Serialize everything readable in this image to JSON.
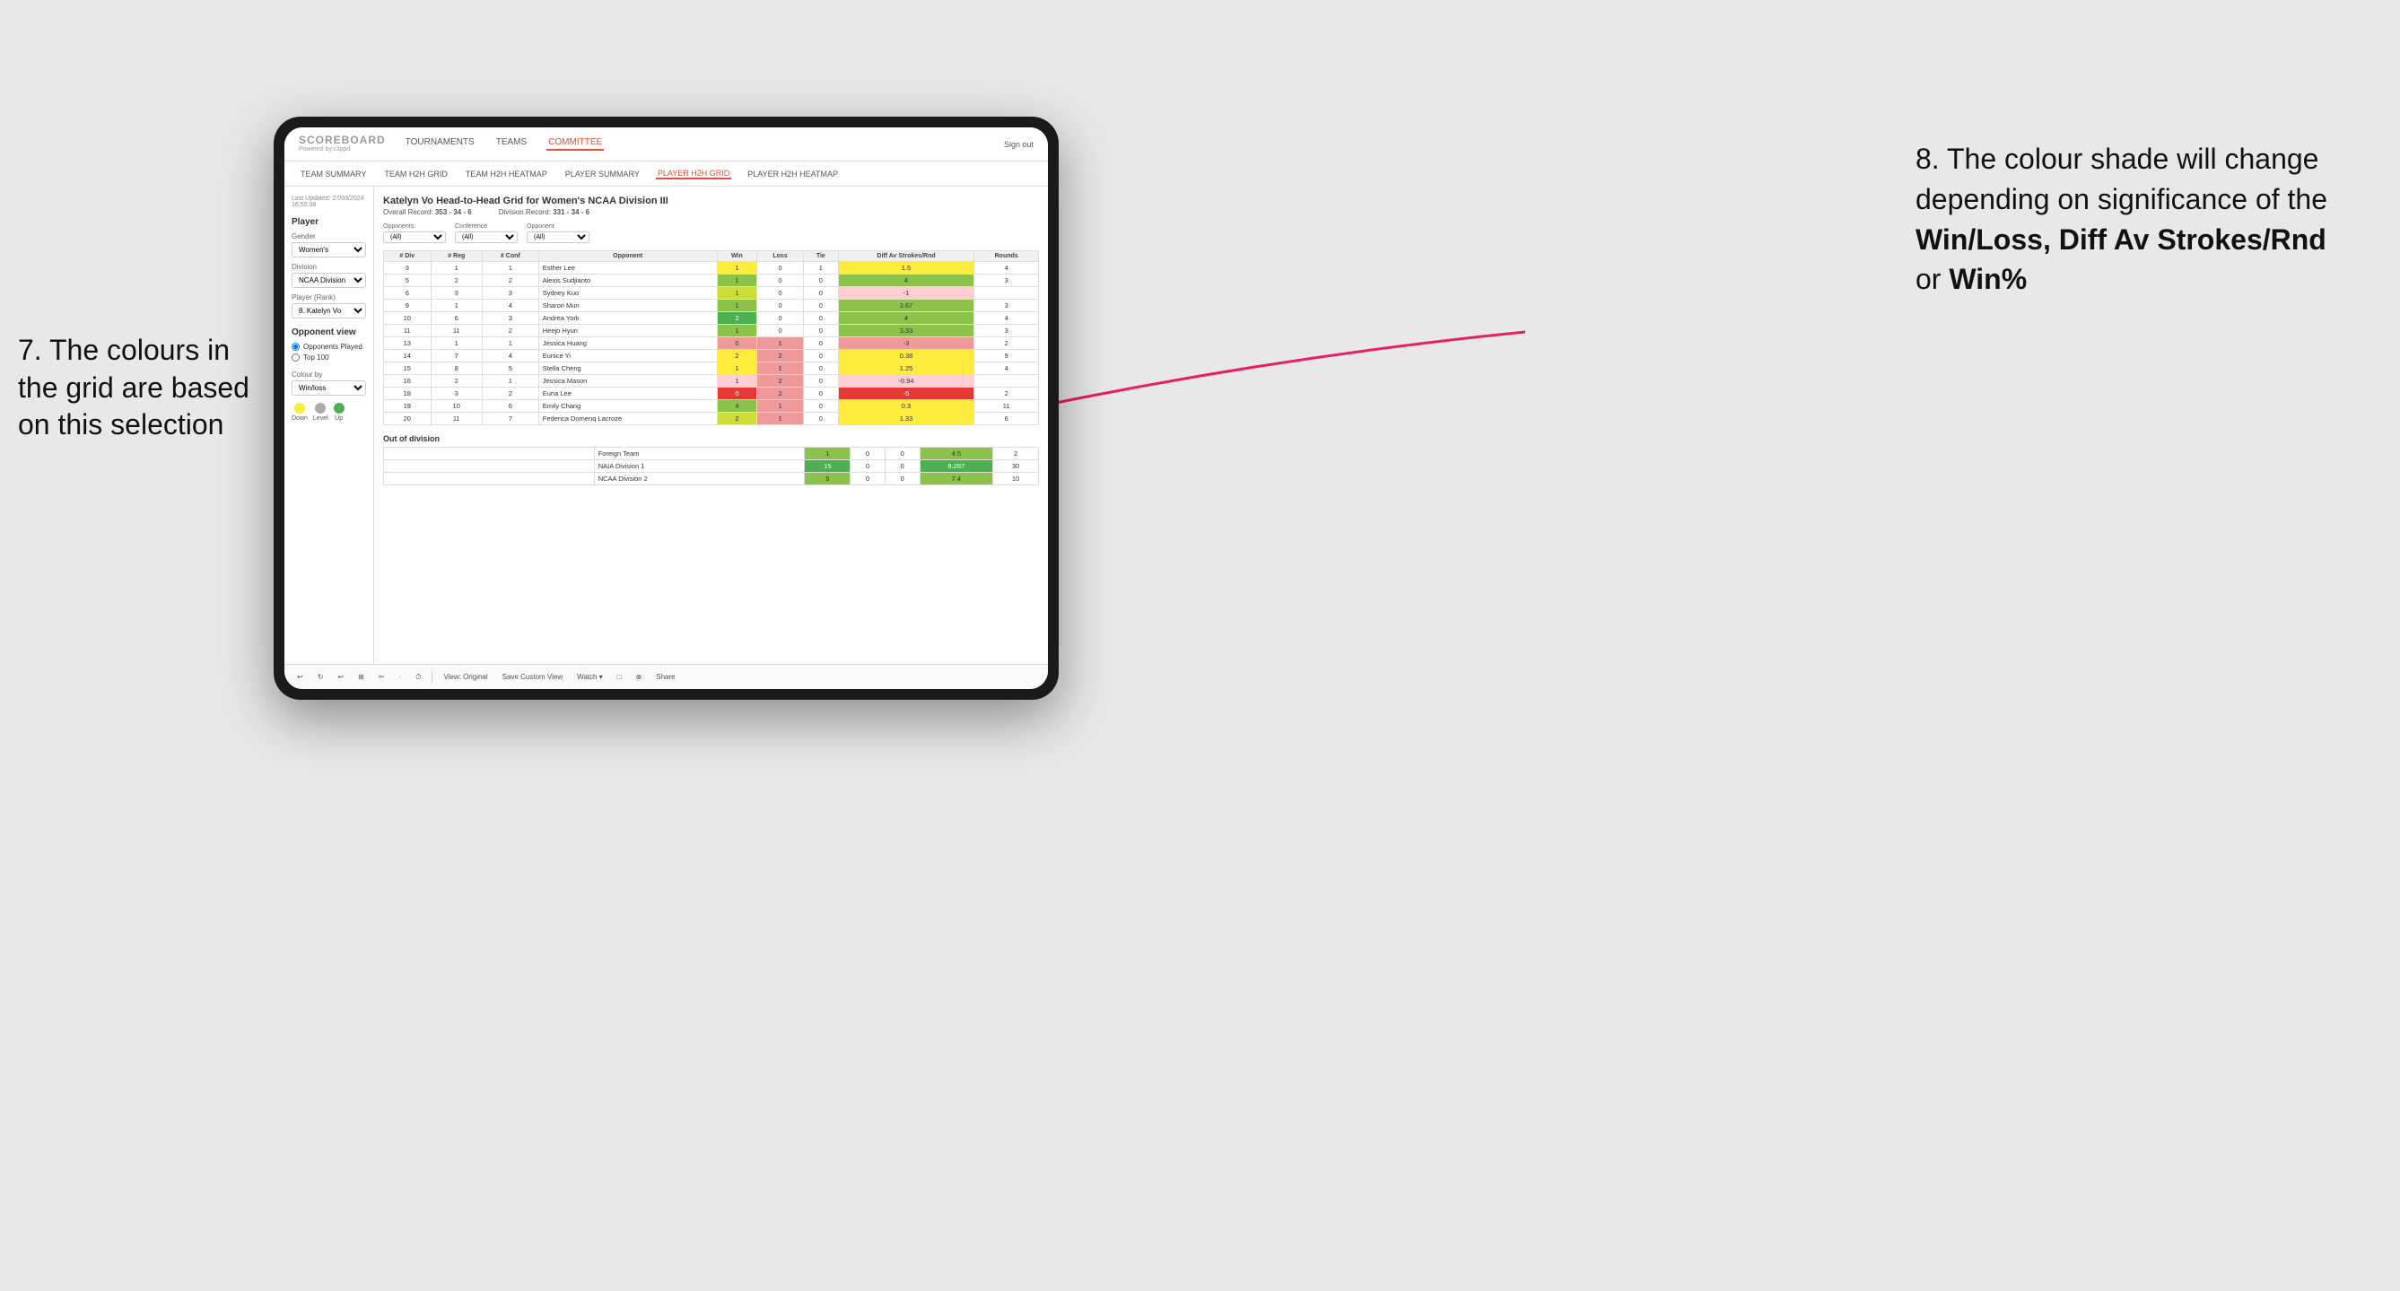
{
  "annotations": {
    "left_title": "7. The colours in the grid are based on this selection",
    "right_title": "8. The colour shade will change depending on significance of the",
    "right_bold1": "Win/Loss,",
    "right_bold2": "Diff Av Strokes/Rnd",
    "right_bold3": "or",
    "right_bold4": "Win%"
  },
  "nav": {
    "logo": "SCOREBOARD",
    "logo_sub": "Powered by clippd",
    "items": [
      "TOURNAMENTS",
      "TEAMS",
      "COMMITTEE"
    ],
    "active": "COMMITTEE",
    "sign_out": "Sign out"
  },
  "sub_nav": {
    "items": [
      "TEAM SUMMARY",
      "TEAM H2H GRID",
      "TEAM H2H HEATMAP",
      "PLAYER SUMMARY",
      "PLAYER H2H GRID",
      "PLAYER H2H HEATMAP"
    ],
    "active": "PLAYER H2H GRID"
  },
  "sidebar": {
    "timestamp": "Last Updated: 27/03/2024 16:55:38",
    "section": "Player",
    "gender_label": "Gender",
    "gender_value": "Women's",
    "division_label": "Division",
    "division_value": "NCAA Division III",
    "player_rank_label": "Player (Rank)",
    "player_rank_value": "8. Katelyn Vo",
    "opponent_view_label": "Opponent view",
    "radio1": "Opponents Played",
    "radio2": "Top 100",
    "colour_by_label": "Colour by",
    "colour_by_value": "Win/loss",
    "legend": [
      {
        "color": "#ffeb3b",
        "label": "Down"
      },
      {
        "color": "#aaaaaa",
        "label": "Level"
      },
      {
        "color": "#4caf50",
        "label": "Up"
      }
    ]
  },
  "grid": {
    "title": "Katelyn Vo Head-to-Head Grid for Women's NCAA Division III",
    "overall_record_label": "Overall Record:",
    "overall_record_value": "353 - 34 - 6",
    "division_record_label": "Division Record:",
    "division_record_value": "331 - 34 - 6",
    "filter_opponents_label": "Opponents:",
    "filter_opponents_value": "(All)",
    "filter_conference_label": "Conference",
    "filter_conference_value": "(All)",
    "filter_opponent_label": "Opponent",
    "filter_opponent_value": "(All)",
    "columns": [
      "# Div",
      "# Reg",
      "# Conf",
      "Opponent",
      "Win",
      "Loss",
      "Tie",
      "Diff Av Strokes/Rnd",
      "Rounds"
    ],
    "rows": [
      {
        "div": "3",
        "reg": "1",
        "conf": "1",
        "opponent": "Esther Lee",
        "win": 1,
        "loss": 0,
        "tie": 1,
        "diff": 1.5,
        "rounds": 4,
        "win_color": "yellow",
        "diff_color": "yellow"
      },
      {
        "div": "5",
        "reg": "2",
        "conf": "2",
        "opponent": "Alexis Sudjianto",
        "win": 1,
        "loss": 0,
        "tie": 0,
        "diff": 4.0,
        "rounds": 3,
        "win_color": "green",
        "diff_color": "green"
      },
      {
        "div": "6",
        "reg": "3",
        "conf": "3",
        "opponent": "Sydney Kuo",
        "win": 1,
        "loss": 0,
        "tie": 0,
        "diff": -1.0,
        "rounds": "",
        "win_color": "green-light",
        "diff_color": "red-light"
      },
      {
        "div": "9",
        "reg": "1",
        "conf": "4",
        "opponent": "Sharon Mun",
        "win": 1,
        "loss": 0,
        "tie": 0,
        "diff": 3.67,
        "rounds": 3,
        "win_color": "green",
        "diff_color": "green"
      },
      {
        "div": "10",
        "reg": "6",
        "conf": "3",
        "opponent": "Andrea York",
        "win": 2,
        "loss": 0,
        "tie": 0,
        "diff": 4.0,
        "rounds": 4,
        "win_color": "green-dark",
        "diff_color": "green"
      },
      {
        "div": "11",
        "reg": "11",
        "conf": "2",
        "opponent": "Heejo Hyun",
        "win": 1,
        "loss": 0,
        "tie": 0,
        "diff": 3.33,
        "rounds": 3,
        "win_color": "green",
        "diff_color": "green"
      },
      {
        "div": "13",
        "reg": "1",
        "conf": "1",
        "opponent": "Jessica Huang",
        "win": 0,
        "loss": 1,
        "tie": 0,
        "diff": -3.0,
        "rounds": 2,
        "win_color": "red",
        "diff_color": "red"
      },
      {
        "div": "14",
        "reg": "7",
        "conf": "4",
        "opponent": "Eunice Yi",
        "win": 2,
        "loss": 2,
        "tie": 0,
        "diff": 0.38,
        "rounds": 9,
        "win_color": "yellow",
        "diff_color": "yellow"
      },
      {
        "div": "15",
        "reg": "8",
        "conf": "5",
        "opponent": "Stella Cheng",
        "win": 1,
        "loss": 1,
        "tie": 0,
        "diff": 1.25,
        "rounds": 4,
        "win_color": "yellow",
        "diff_color": "yellow"
      },
      {
        "div": "16",
        "reg": "2",
        "conf": "1",
        "opponent": "Jessica Mason",
        "win": 1,
        "loss": 2,
        "tie": 0,
        "diff": -0.94,
        "rounds": "",
        "win_color": "red-light",
        "diff_color": "red-light"
      },
      {
        "div": "18",
        "reg": "3",
        "conf": "2",
        "opponent": "Euna Lee",
        "win": 0,
        "loss": 2,
        "tie": 0,
        "diff": -5.0,
        "rounds": 2,
        "win_color": "red-dark",
        "diff_color": "red-dark"
      },
      {
        "div": "19",
        "reg": "10",
        "conf": "6",
        "opponent": "Emily Chang",
        "win": 4,
        "loss": 1,
        "tie": 0,
        "diff": 0.3,
        "rounds": 11,
        "win_color": "green",
        "diff_color": "yellow"
      },
      {
        "div": "20",
        "reg": "11",
        "conf": "7",
        "opponent": "Federica Domenq Lacroze",
        "win": 2,
        "loss": 1,
        "tie": 0,
        "diff": 1.33,
        "rounds": 6,
        "win_color": "green-light",
        "diff_color": "yellow"
      }
    ],
    "out_of_division_label": "Out of division",
    "out_of_division_rows": [
      {
        "name": "Foreign Team",
        "win": 1,
        "loss": 0,
        "tie": 0,
        "diff": 4.5,
        "rounds": 2,
        "win_color": "green",
        "diff_color": "green"
      },
      {
        "name": "NAIA Division 1",
        "win": 15,
        "loss": 0,
        "tie": 0,
        "diff": 9.267,
        "rounds": 30,
        "win_color": "green-dark",
        "diff_color": "green-dark"
      },
      {
        "name": "NCAA Division 2",
        "win": 5,
        "loss": 0,
        "tie": 0,
        "diff": 7.4,
        "rounds": 10,
        "win_color": "green",
        "diff_color": "green"
      }
    ]
  },
  "toolbar": {
    "buttons": [
      "↩",
      "↻",
      "↩",
      "⊞",
      "✂",
      "·",
      "⏱",
      "|",
      "View: Original",
      "Save Custom View",
      "Watch ▾",
      "□",
      "⊕",
      "Share"
    ]
  }
}
